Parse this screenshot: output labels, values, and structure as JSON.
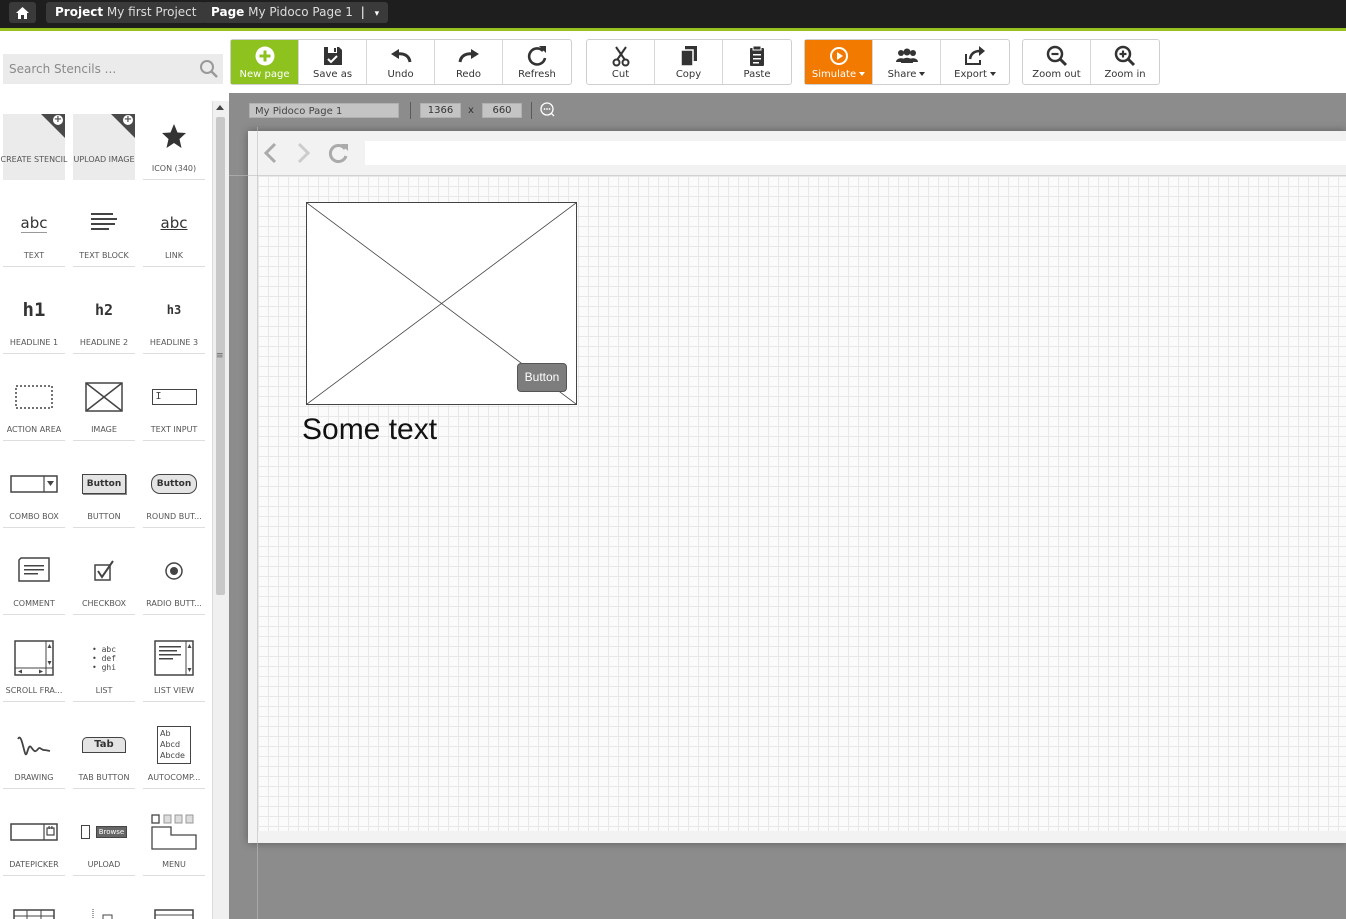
{
  "topbar": {
    "home_icon": "home-icon",
    "project_label": "Project",
    "project_name": "My first Project",
    "page_label": "Page",
    "page_name": "My Pidoco Page 1",
    "page_sep": "|",
    "page_caret": "▾",
    "accent_color": "#97c21f"
  },
  "sidebar": {
    "search_placeholder": "Search Stencils ...",
    "stencils": [
      {
        "label": "CREATE STENCIL",
        "icon": "create-stencil-icon"
      },
      {
        "label": "UPLOAD IMAGE",
        "icon": "upload-image-icon"
      },
      {
        "label": "ICON (340)",
        "icon": "star-icon"
      },
      {
        "label": "TEXT",
        "icon": "text-icon",
        "glyph": "abc"
      },
      {
        "label": "TEXT BLOCK",
        "icon": "text-block-icon"
      },
      {
        "label": "LINK",
        "icon": "link-icon",
        "glyph": "abc"
      },
      {
        "label": "HEADLINE 1",
        "icon": "headline-1-icon",
        "glyph": "h1"
      },
      {
        "label": "HEADLINE 2",
        "icon": "headline-2-icon",
        "glyph": "h2"
      },
      {
        "label": "HEADLINE 3",
        "icon": "headline-3-icon",
        "glyph": "h3"
      },
      {
        "label": "ACTION AREA",
        "icon": "action-area-icon"
      },
      {
        "label": "IMAGE",
        "icon": "image-icon"
      },
      {
        "label": "TEXT INPUT",
        "icon": "text-input-icon",
        "glyph": "I"
      },
      {
        "label": "COMBO BOX",
        "icon": "combo-box-icon"
      },
      {
        "label": "BUTTON",
        "icon": "button-icon",
        "glyph": "Button"
      },
      {
        "label": "ROUND BUT...",
        "icon": "round-button-icon",
        "glyph": "Button"
      },
      {
        "label": "COMMENT",
        "icon": "comment-icon"
      },
      {
        "label": "CHECKBOX",
        "icon": "checkbox-icon"
      },
      {
        "label": "RADIO BUTT...",
        "icon": "radio-button-icon"
      },
      {
        "label": "SCROLL FRA...",
        "icon": "scroll-frame-icon"
      },
      {
        "label": "LIST",
        "icon": "list-icon",
        "glyph": "• abc\n• def\n• ghi"
      },
      {
        "label": "LIST VIEW",
        "icon": "list-view-icon"
      },
      {
        "label": "DRAWING",
        "icon": "drawing-icon"
      },
      {
        "label": "TAB BUTTON",
        "icon": "tab-button-icon",
        "glyph": "Tab"
      },
      {
        "label": "AUTOCOMP...",
        "icon": "autocomplete-icon",
        "glyph": "Ab\nAbcd\nAbcde"
      },
      {
        "label": "DATEPICKER",
        "icon": "datepicker-icon"
      },
      {
        "label": "UPLOAD",
        "icon": "upload-icon",
        "glyph": "Browse"
      },
      {
        "label": "MENU",
        "icon": "menu-icon"
      },
      {
        "label": "",
        "icon": "table-icon"
      },
      {
        "label": "",
        "icon": "tree-icon"
      },
      {
        "label": "",
        "icon": "window-icon"
      }
    ],
    "grip": "≡"
  },
  "toolbar": {
    "file_group": [
      {
        "label": "New page",
        "icon": "new-page-icon",
        "style": "green"
      },
      {
        "label": "Save as",
        "icon": "save-as-icon"
      },
      {
        "label": "Undo",
        "icon": "undo-icon"
      },
      {
        "label": "Redo",
        "icon": "redo-icon"
      },
      {
        "label": "Refresh",
        "icon": "refresh-icon"
      }
    ],
    "edit_group": [
      {
        "label": "Cut",
        "icon": "scissors-icon"
      },
      {
        "label": "Copy",
        "icon": "copy-icon"
      },
      {
        "label": "Paste",
        "icon": "paste-icon"
      }
    ],
    "share_group": [
      {
        "label": "Simulate",
        "icon": "play-icon",
        "style": "orange",
        "dropdown": true
      },
      {
        "label": "Share",
        "icon": "people-icon",
        "dropdown": true
      },
      {
        "label": "Export",
        "icon": "export-icon",
        "dropdown": true
      }
    ],
    "zoom_group": [
      {
        "label": "Zoom out",
        "icon": "zoom-out-icon"
      },
      {
        "label": "Zoom in",
        "icon": "zoom-in-icon"
      }
    ],
    "green_color": "#8dc21f",
    "orange_color": "#f27a00"
  },
  "canvas": {
    "page_name": "My Pidoco Page 1",
    "width": "1366",
    "x_label": "x",
    "height": "660",
    "widgets": {
      "image_placeholder": "image-placeholder",
      "button_label": "Button",
      "text": "Some text"
    }
  }
}
